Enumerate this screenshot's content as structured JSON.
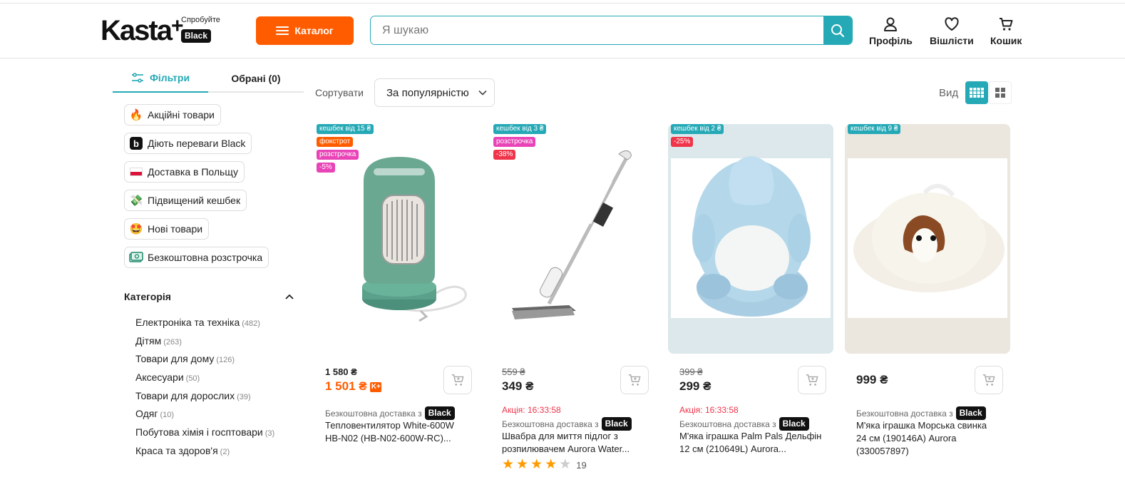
{
  "header": {
    "logo": "Kasta",
    "logo_plus": "+",
    "try_text": "Спробуйте",
    "black_label": "Black",
    "catalog_label": "Каталог",
    "search_placeholder": "Я шукаю",
    "nav": [
      {
        "label": "Профіль",
        "icon": "user-icon"
      },
      {
        "label": "Вішлісти",
        "icon": "heart-icon"
      },
      {
        "label": "Кошик",
        "icon": "cart-icon"
      }
    ]
  },
  "sidebar": {
    "tabs": [
      {
        "label": "Фільтри",
        "active": true
      },
      {
        "label": "Обрані (0)",
        "active": false
      }
    ],
    "chips": [
      {
        "label": "Акційні товари",
        "icon": "fire-icon",
        "glyph": "🔥"
      },
      {
        "label": "Діють переваги Black",
        "icon": "black-b-icon",
        "glyph": "b"
      },
      {
        "label": "Доставка в Польщу",
        "icon": "poland-flag-icon",
        "glyph": ""
      },
      {
        "label": "Підвищений кешбек",
        "icon": "money-icon",
        "glyph": "💸"
      },
      {
        "label": "Нові товари",
        "icon": "star-eyes-icon",
        "glyph": "🤩"
      },
      {
        "label": "Безкоштовна розстрочка",
        "icon": "cash-icon",
        "glyph": ""
      }
    ],
    "categories_title": "Категорія",
    "categories": [
      {
        "name": "Електроніка та техніка",
        "count": "(482)"
      },
      {
        "name": "Дітям",
        "count": "(263)"
      },
      {
        "name": "Товари для дому",
        "count": "(126)"
      },
      {
        "name": "Аксесуари",
        "count": "(50)"
      },
      {
        "name": "Товари для дорослих",
        "count": "(39)"
      },
      {
        "name": "Одяг",
        "count": "(10)"
      },
      {
        "name": "Побутова хімія і госптовари",
        "count": "(3)"
      },
      {
        "name": "Краса та здоров'я",
        "count": "(2)"
      }
    ]
  },
  "toolbar": {
    "sort_label": "Сортувати",
    "sort_value": "За популярністю",
    "view_label": "Вид"
  },
  "products": [
    {
      "badges": [
        "кешбек від 15 ₴",
        "фокстрот",
        "розстрочка",
        "-5%"
      ],
      "old_price": "1 580 ₴",
      "price": "1 501 ₴",
      "promo": "",
      "delivery": "Безкоштовна доставка з",
      "title": "Тепловентилятор White-600W HB-N02 (HB-N02-600W-RC)...",
      "rating_count": ""
    },
    {
      "badges": [
        "кешбек від 3 ₴",
        "розстрочка",
        "-38%"
      ],
      "old_price": "559 ₴",
      "price": "349 ₴",
      "promo": "Акція: 16:33:58",
      "delivery": "Безкоштовна доставка з",
      "title": "Швабра для миття підлог з розпилювачем Aurora Water...",
      "rating": 4,
      "rating_count": "19"
    },
    {
      "badges": [
        "кешбек від 2 ₴",
        "-25%"
      ],
      "old_price": "399 ₴",
      "price": "299 ₴",
      "promo": "Акція: 16:33:58",
      "delivery": "Безкоштовна доставка з",
      "title": "М'яка іграшка Palm Pals Дельфін 12 см (210649L) Aurora...",
      "rating_count": ""
    },
    {
      "badges": [
        "кешбек від 9 ₴"
      ],
      "old_price": "",
      "price": "999 ₴",
      "promo": "",
      "delivery": "Безкоштовна доставка з",
      "title": "М'яка іграшка Морська свинка 24 см (190146A) Aurora (330057897)",
      "rating_count": ""
    }
  ],
  "colors": {
    "accent": "#25a9b6",
    "brand_orange": "#ff5c00",
    "promo_red": "#f0344a",
    "badge_pink": "#e944b7"
  }
}
